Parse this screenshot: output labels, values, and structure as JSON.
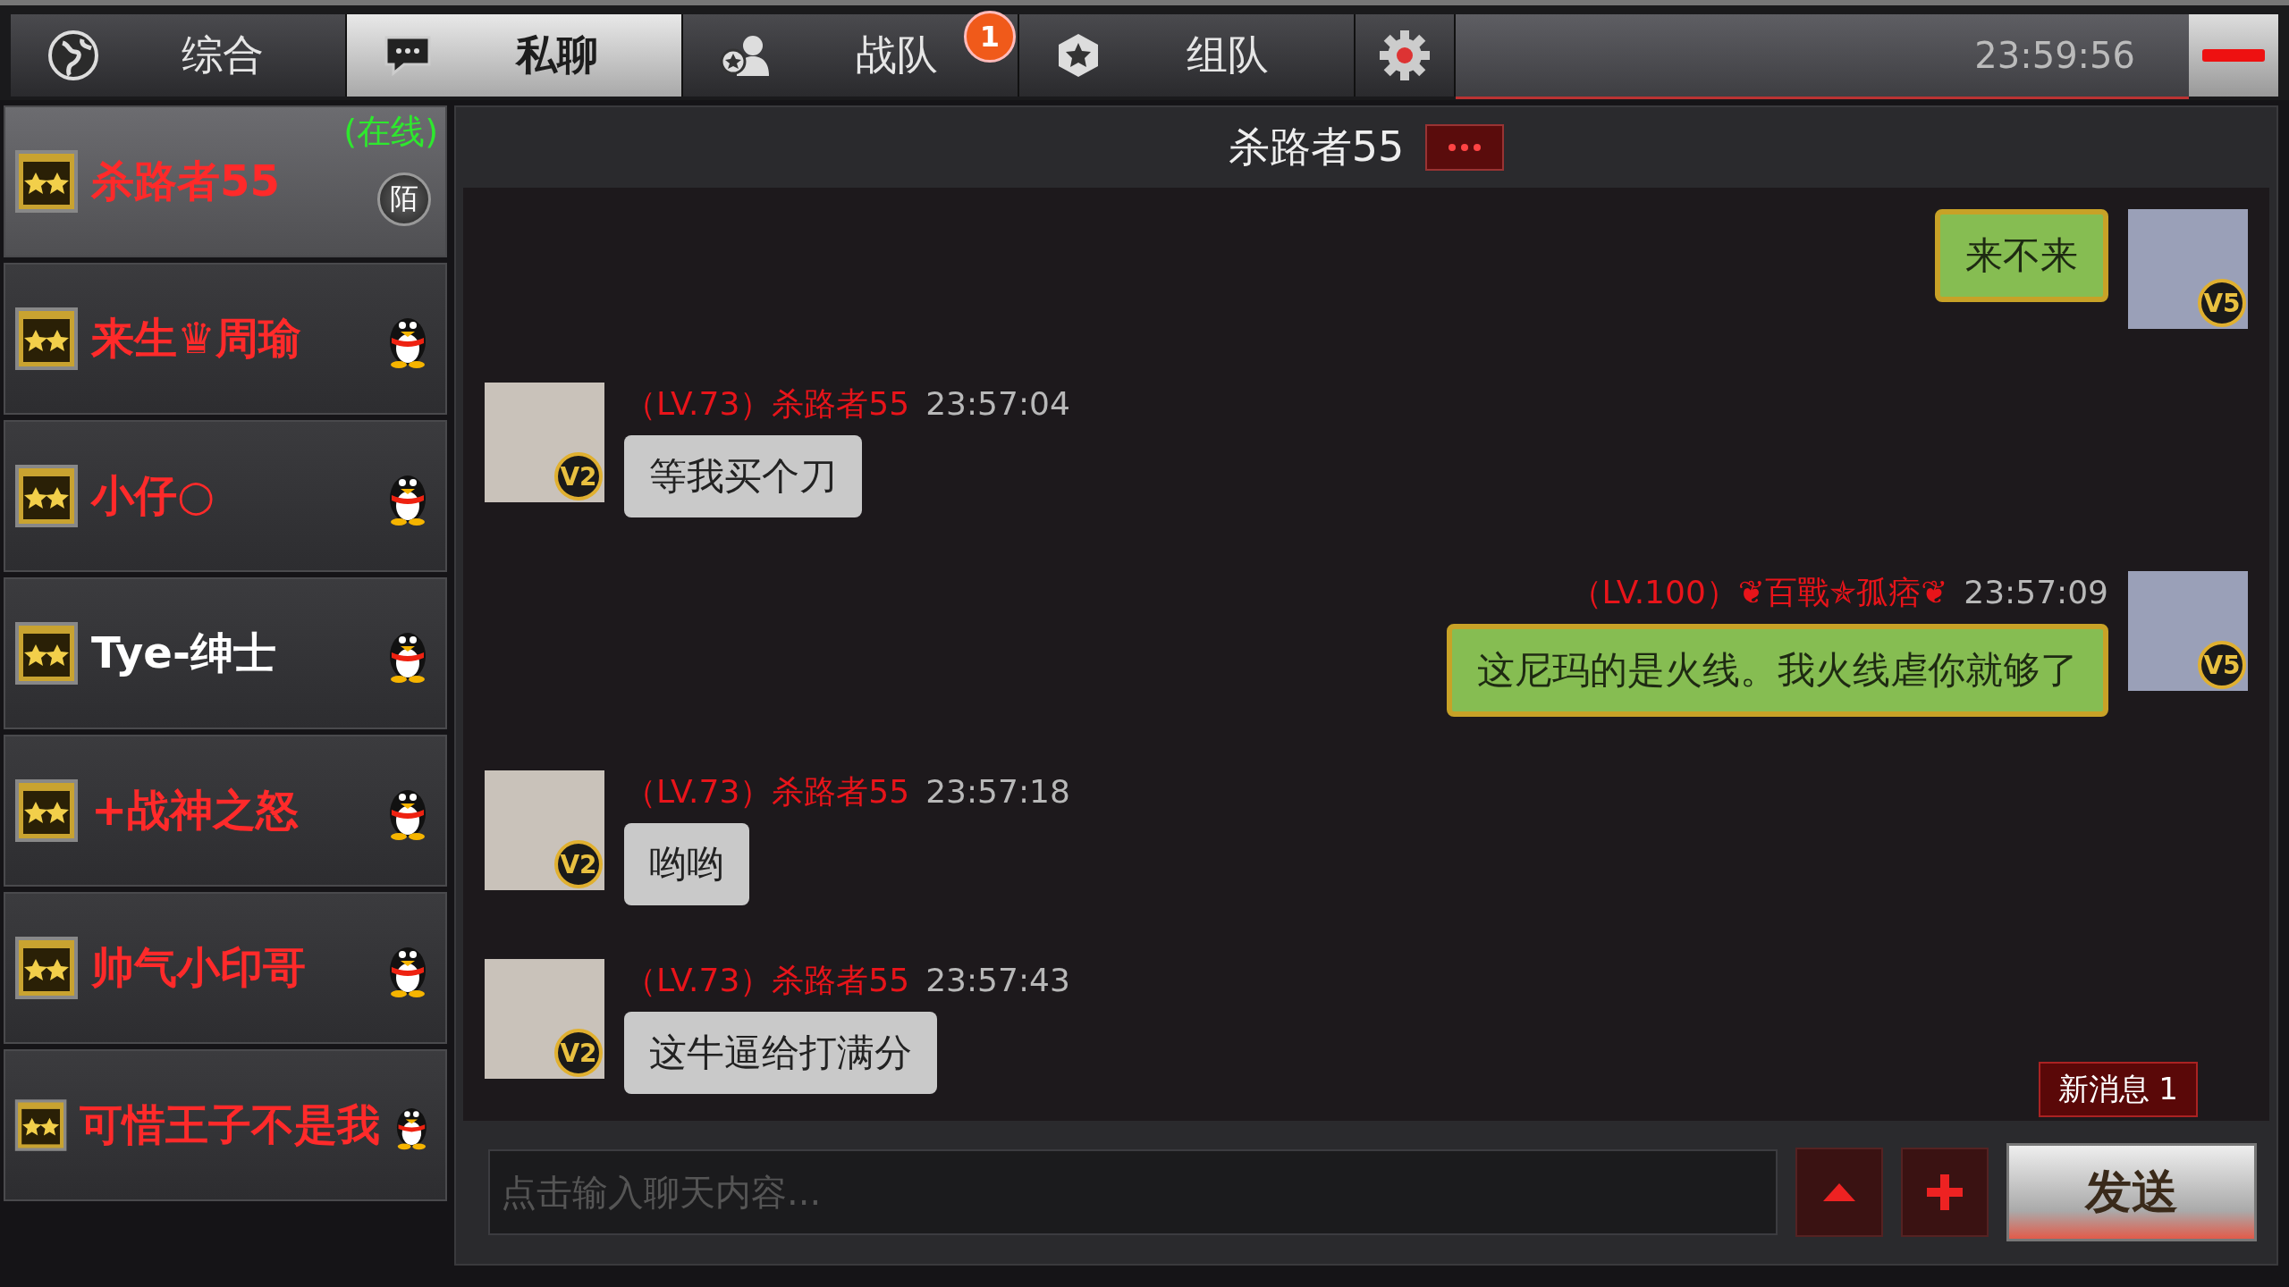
{
  "top_bar": {
    "tabs": [
      {
        "label": "综合",
        "kind": "general",
        "selected": false
      },
      {
        "label": "私聊",
        "kind": "private",
        "selected": true
      },
      {
        "label": "战队",
        "kind": "clan",
        "selected": false,
        "badge": "1"
      },
      {
        "label": "组队",
        "kind": "squad",
        "selected": false
      }
    ],
    "clock": "23:59:56"
  },
  "contacts": [
    {
      "name": "杀路者55",
      "color": "#ff2a2a",
      "status": "(在线)",
      "kind": "stranger",
      "badge": "陌",
      "selected": true
    },
    {
      "name": "来生♛周瑜",
      "color": "#ff2a2a",
      "kind": "qq",
      "selected": false
    },
    {
      "name": "小仔○",
      "color": "#ff2a2a",
      "kind": "qq",
      "selected": false
    },
    {
      "name": "Tye-绅士",
      "color": "#ffffff",
      "kind": "qq",
      "selected": false
    },
    {
      "name": "+战神之怒",
      "color": "#ff2a2a",
      "kind": "qq",
      "selected": false
    },
    {
      "name": "帅气小印哥",
      "color": "#ff2a2a",
      "kind": "qq",
      "selected": false
    },
    {
      "name": "可惜王子不是我",
      "color": "#ff2a2a",
      "kind": "qq",
      "selected": false
    }
  ],
  "chat": {
    "title": "杀路者55",
    "messages": [
      {
        "kind": "outgoing",
        "text": "来不来",
        "vip": "V5"
      },
      {
        "kind": "incoming",
        "level": "（LV.73）",
        "name": "杀路者55",
        "time": "23:57:04",
        "text": "等我买个刀",
        "vip": "V2"
      },
      {
        "kind": "outgoing",
        "level": "（LV.100）",
        "name": "❦百戰✯孤痞❦",
        "time": "23:57:09",
        "text": "这尼玛的是火线。我火线虐你就够了",
        "vip": "V5"
      },
      {
        "kind": "incoming",
        "level": "（LV.73）",
        "name": "杀路者55",
        "time": "23:57:18",
        "text": "哟哟",
        "vip": "V2"
      },
      {
        "kind": "incoming",
        "level": "（LV.73）",
        "name": "杀路者55",
        "time": "23:57:43",
        "text": "这牛逼给打满分",
        "vip": "V2"
      }
    ],
    "new_message_badge": "新消息  1",
    "input": {
      "placeholder": "点击输入聊天内容..."
    },
    "send_button": "发送"
  }
}
